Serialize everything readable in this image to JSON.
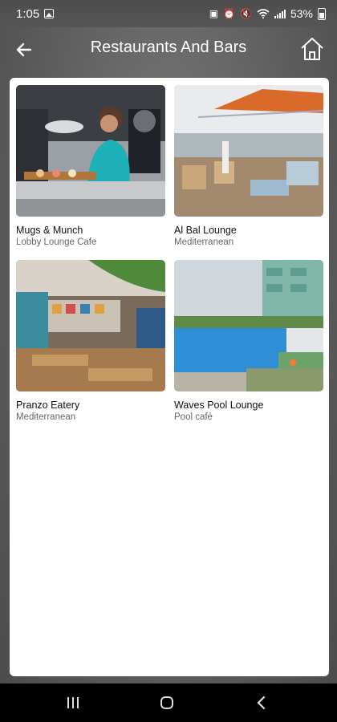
{
  "status_bar": {
    "time": "1:05",
    "battery": "53%",
    "icons": [
      "gallery-icon",
      "lock-icon",
      "alarm-icon",
      "mute-icon",
      "wifi-icon",
      "signal-icon",
      "battery-icon"
    ]
  },
  "header": {
    "title": "Restaurants And Bars",
    "back_icon": "back-arrow-icon",
    "home_icon": "home-icon"
  },
  "venues": [
    {
      "name": "Mugs & Munch",
      "subtitle": "Lobby Lounge Cafe"
    },
    {
      "name": "Al Bal Lounge",
      "subtitle": "Mediterranean"
    },
    {
      "name": "Pranzo Eatery",
      "subtitle": "Mediterranean"
    },
    {
      "name": "Waves Pool Lounge",
      "subtitle": "Pool café"
    }
  ],
  "nav_bar": {
    "icons": [
      "recent-apps-icon",
      "home-circle-icon",
      "back-chevron-icon"
    ]
  },
  "colors": {
    "background": "#5e5e5e",
    "panel": "#ffffff",
    "navbar": "#000000"
  }
}
